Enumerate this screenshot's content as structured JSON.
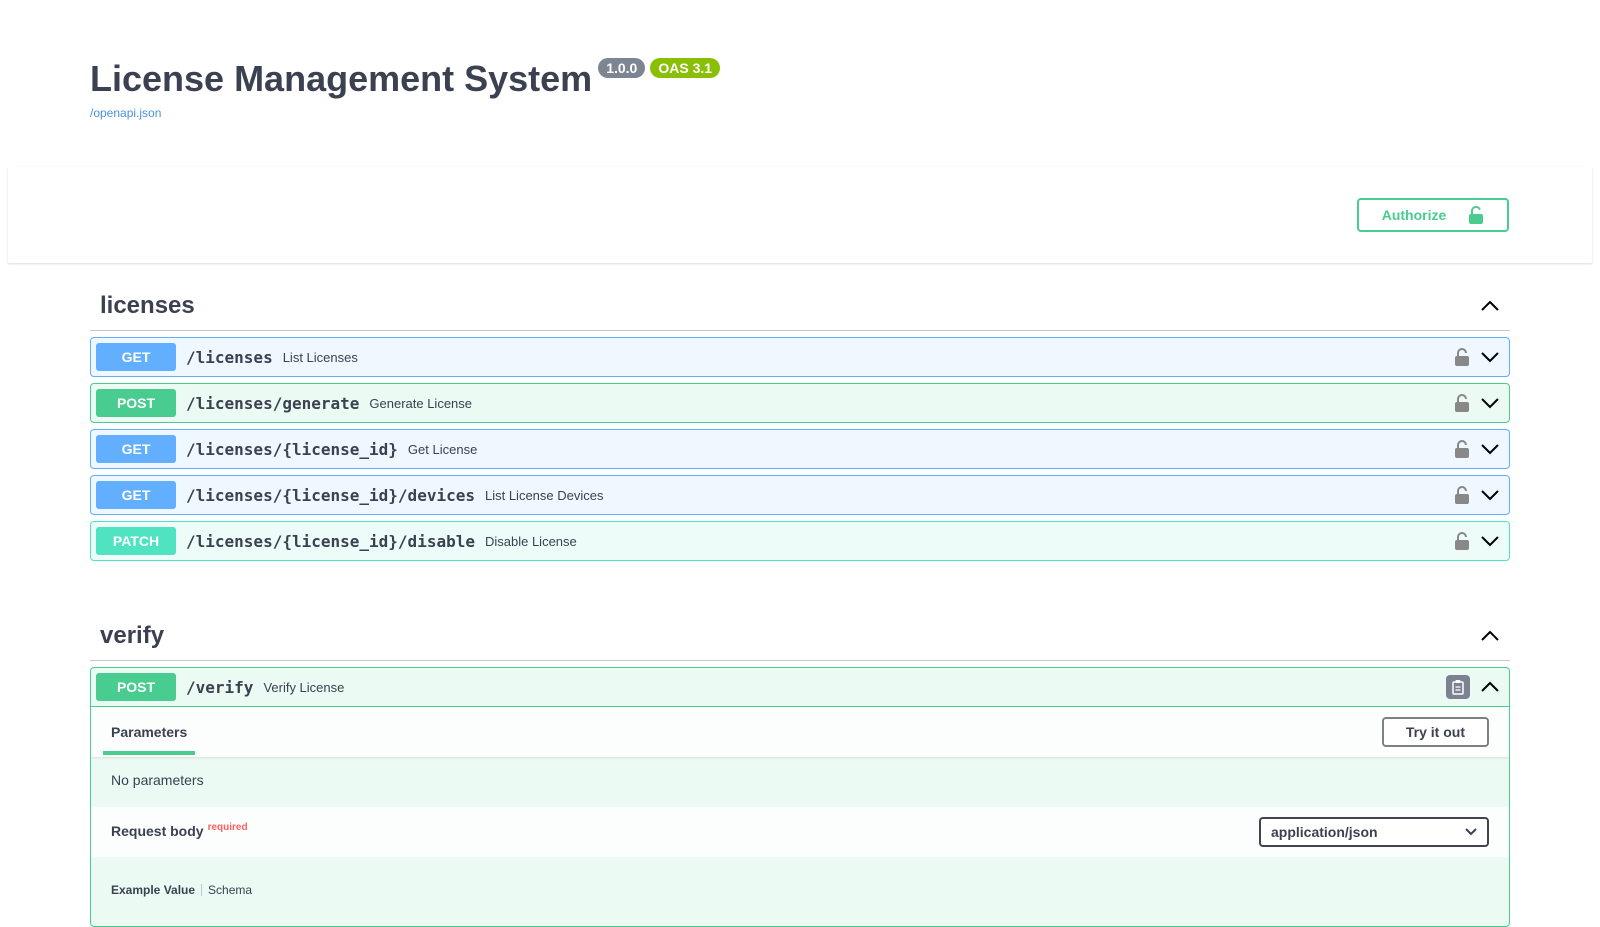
{
  "info": {
    "title": "License Management System",
    "version": "1.0.0",
    "oas": "OAS 3.1",
    "spec_link": "/openapi.json"
  },
  "scheme": {
    "authorize_label": "Authorize"
  },
  "colors": {
    "get": "#61affe",
    "post": "#49cc90",
    "patch": "#50e3c2",
    "authorize": "#49cc90"
  },
  "tags": [
    {
      "name": "licenses",
      "operations": [
        {
          "method": "GET",
          "path": "/licenses",
          "summary": "List Licenses"
        },
        {
          "method": "POST",
          "path": "/licenses/generate",
          "summary": "Generate License"
        },
        {
          "method": "GET",
          "path": "/licenses/{license_id}",
          "summary": "Get License"
        },
        {
          "method": "GET",
          "path": "/licenses/{license_id}/devices",
          "summary": "List License Devices"
        },
        {
          "method": "PATCH",
          "path": "/licenses/{license_id}/disable",
          "summary": "Disable License"
        }
      ]
    },
    {
      "name": "verify",
      "operations": [
        {
          "method": "POST",
          "path": "/verify",
          "summary": "Verify License"
        }
      ]
    }
  ],
  "verify_detail": {
    "parameters_tab": "Parameters",
    "try_label": "Try it out",
    "no_params": "No parameters",
    "request_body": "Request body",
    "required": "required",
    "content_type": "application/json",
    "example_value_tab": "Example Value",
    "schema_tab": "Schema"
  }
}
